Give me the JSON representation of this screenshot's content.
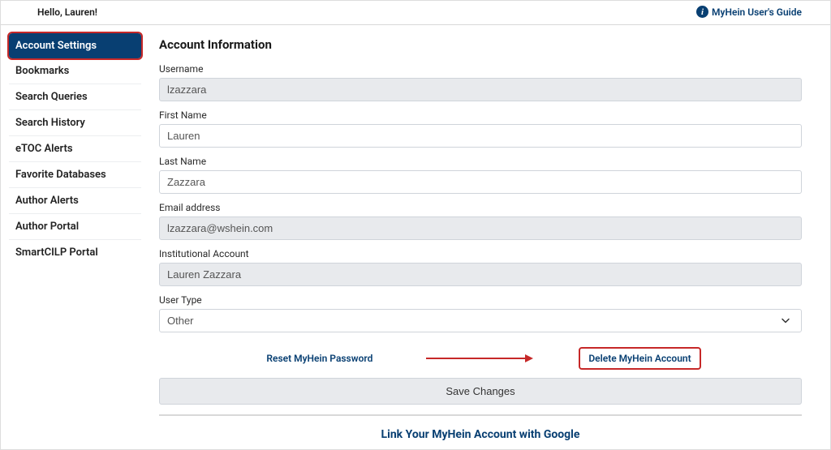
{
  "topbar": {
    "greeting": "Hello, Lauren!",
    "guide_label": "MyHein User's Guide"
  },
  "sidebar": {
    "items": [
      {
        "label": "Account Settings",
        "active": true,
        "highlighted": true
      },
      {
        "label": "Bookmarks",
        "active": false,
        "highlighted": false
      },
      {
        "label": "Search Queries",
        "active": false,
        "highlighted": false
      },
      {
        "label": "Search History",
        "active": false,
        "highlighted": false
      },
      {
        "label": "eTOC Alerts",
        "active": false,
        "highlighted": false
      },
      {
        "label": "Favorite Databases",
        "active": false,
        "highlighted": false
      },
      {
        "label": "Author Alerts",
        "active": false,
        "highlighted": false
      },
      {
        "label": "Author Portal",
        "active": false,
        "highlighted": false
      },
      {
        "label": "SmartCILP Portal",
        "active": false,
        "highlighted": false
      }
    ]
  },
  "main": {
    "title": "Account Information",
    "fields": {
      "username": {
        "label": "Username",
        "value": "lzazzara",
        "readonly": true
      },
      "first_name": {
        "label": "First Name",
        "value": "Lauren",
        "readonly": false
      },
      "last_name": {
        "label": "Last Name",
        "value": "Zazzara",
        "readonly": false
      },
      "email": {
        "label": "Email address",
        "value": "lzazzara@wshein.com",
        "readonly": true
      },
      "institution": {
        "label": "Institutional Account",
        "value": "Lauren Zazzara",
        "readonly": true
      },
      "user_type": {
        "label": "User Type",
        "value": "Other"
      }
    },
    "actions": {
      "reset_password": "Reset MyHein Password",
      "delete_account": "Delete MyHein Account",
      "save_button": "Save Changes"
    },
    "footer_link": "Link Your MyHein Account with Google"
  },
  "colors": {
    "primary": "#083f72",
    "annotation": "#c62828",
    "readonly_bg": "#e8eaed"
  }
}
